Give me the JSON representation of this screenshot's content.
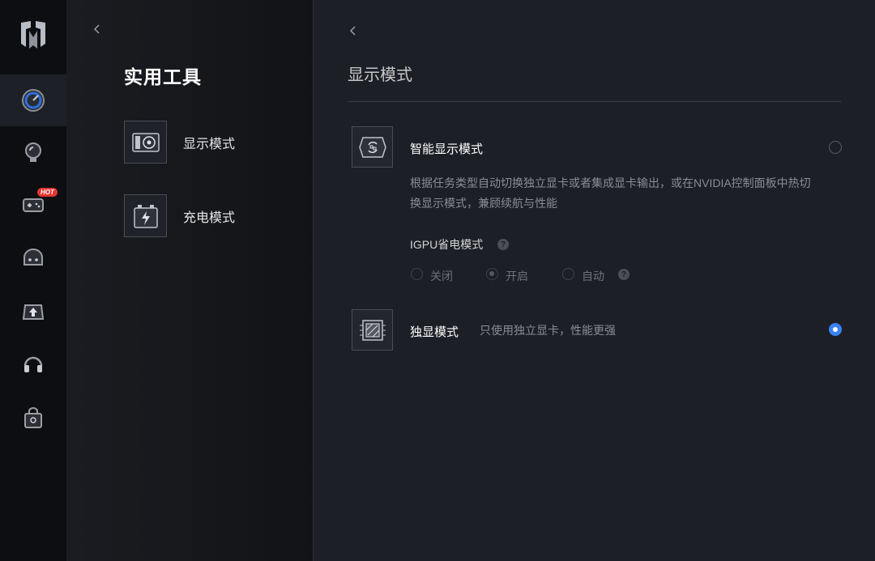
{
  "rail": {
    "items": [
      {
        "name": "performance",
        "active": true
      },
      {
        "name": "lighting",
        "active": false
      },
      {
        "name": "games",
        "active": false,
        "badge": "HOT"
      },
      {
        "name": "assistant",
        "active": false
      },
      {
        "name": "update",
        "active": false
      },
      {
        "name": "audio",
        "active": false
      },
      {
        "name": "store",
        "active": false
      }
    ],
    "hot_badge": "HOT"
  },
  "middle": {
    "title": "实用工具",
    "tools": [
      {
        "label": "显示模式",
        "icon": "gpu-card-icon"
      },
      {
        "label": "充电模式",
        "icon": "battery-charge-icon"
      }
    ]
  },
  "right": {
    "title": "显示模式",
    "options": [
      {
        "title": "智能显示模式",
        "desc_line1": "根据任务类型自动切换独立显卡或者集成显卡输出，或在NVIDIA控制面板中热切",
        "desc_line2": "换显示模式，兼顾续航与性能",
        "selected": false
      },
      {
        "title": "独显模式",
        "desc": "只使用独立显卡，性能更强",
        "selected": true
      }
    ],
    "igpu": {
      "label": "IGPU省电模式",
      "help": "?",
      "choices": [
        "关闭",
        "开启",
        "自动"
      ],
      "selected": "开启"
    }
  },
  "colors": {
    "accent": "#3b82f6",
    "hot": "#e5362f"
  }
}
